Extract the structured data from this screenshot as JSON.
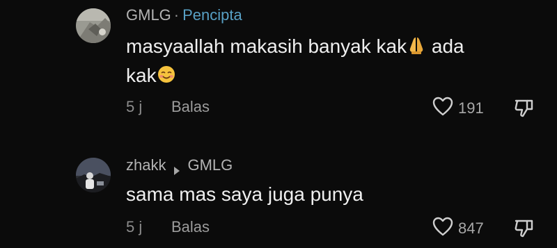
{
  "comments": [
    {
      "username": "GMLG",
      "separator": "·",
      "creator_badge": "Pencipta",
      "text_line1": "masyaallah makasih banyak kak",
      "text_line1b": " ada",
      "text_line2": "kak",
      "time": "5 j",
      "reply_label": "Balas",
      "likes": "191",
      "emojis": [
        "folded-hands",
        "smiling-face"
      ]
    },
    {
      "username": "zhakk",
      "reply_to": "GMLG",
      "text": "sama mas saya juga punya",
      "time": "5 j",
      "reply_label": "Balas",
      "likes": "847"
    }
  ],
  "colors": {
    "background": "#0b0b0b",
    "creator_badge": "#58a0c4",
    "primary_text": "#efefef",
    "secondary_text": "#a6a6a6"
  },
  "icons": [
    "heart-icon",
    "dislike-icon",
    "reply-arrow-icon"
  ]
}
